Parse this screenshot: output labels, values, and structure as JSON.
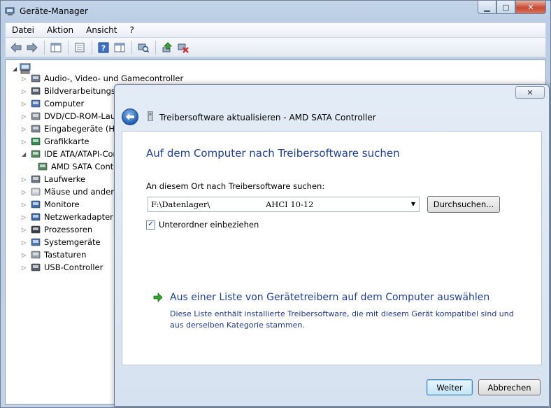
{
  "window": {
    "title": "Geräte-Manager"
  },
  "menu": [
    "Datei",
    "Aktion",
    "Ansicht",
    "?"
  ],
  "toolbar_icons": [
    "back-arrow-icon",
    "forward-arrow-icon",
    "properties-icon",
    "help-icon",
    "scan-hardware-icon",
    "update-driver-icon",
    "uninstall-icon"
  ],
  "tree": {
    "items": [
      {
        "label": "Audio-, Video- und Gamecontroller",
        "icon": "speaker-icon"
      },
      {
        "label": "Bildverarbeitungsgeräte",
        "icon": "camera-icon"
      },
      {
        "label": "Computer",
        "icon": "computer-icon"
      },
      {
        "label": "DVD/CD-ROM-Laufwerke",
        "icon": "dvd-icon"
      },
      {
        "label": "Eingabegeräte (HID)",
        "icon": "hid-icon"
      },
      {
        "label": "Grafikkarte",
        "icon": "display-adapter-icon"
      },
      {
        "label": "IDE ATA/ATAPI-Controller",
        "icon": "ide-controller-icon"
      },
      {
        "label": "AMD SATA Controller",
        "icon": "sata-controller-icon",
        "child": true
      },
      {
        "label": "Laufwerke",
        "icon": "disk-drive-icon"
      },
      {
        "label": "Mäuse und andere Zeigegeräte",
        "icon": "mouse-icon"
      },
      {
        "label": "Monitore",
        "icon": "monitor-icon"
      },
      {
        "label": "Netzwerkadapter",
        "icon": "network-icon"
      },
      {
        "label": "Prozessoren",
        "icon": "processor-icon"
      },
      {
        "label": "Systemgeräte",
        "icon": "system-device-icon"
      },
      {
        "label": "Tastaturen",
        "icon": "keyboard-icon"
      },
      {
        "label": "USB-Controller",
        "icon": "usb-icon"
      }
    ]
  },
  "dialog": {
    "title": "Treibersoftware aktualisieren - AMD SATA Controller",
    "heading": "Auf dem Computer nach Treibersoftware suchen",
    "location_label": "An diesem Ort nach Treibersoftware suchen:",
    "path_part1": "F:\\Datenlager\\",
    "path_part2": "AHCI 10-12",
    "browse_label": "Durchsuchen...",
    "subfolder_label": "Unterordner einbeziehen",
    "subfolder_checked": true,
    "list_option_title": "Aus einer Liste von Gerätetreibern auf dem Computer auswählen",
    "list_option_desc": "Diese Liste enthält installierte Treibersoftware, die mit diesem Gerät kompatibel sind und aus derselben Kategorie stammen.",
    "next_label": "Weiter",
    "cancel_label": "Abbrechen"
  }
}
